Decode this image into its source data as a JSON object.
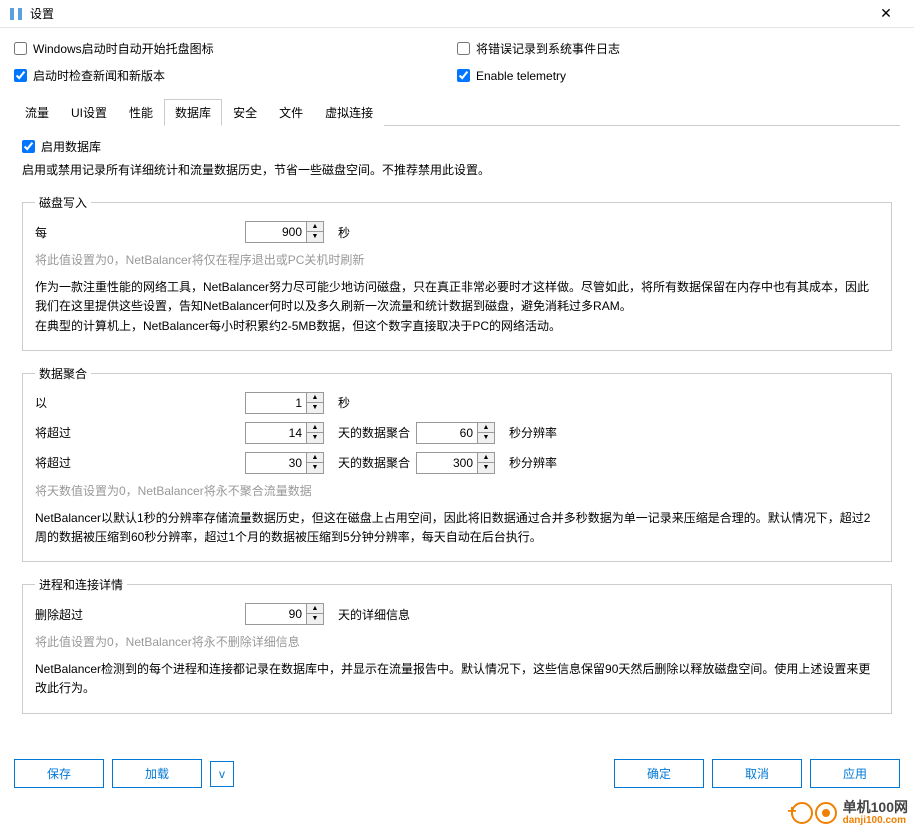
{
  "window": {
    "title": "设置",
    "close": "✕"
  },
  "checkboxes": {
    "tray": {
      "label": "Windows启动时自动开始托盘图标",
      "checked": false
    },
    "syslog": {
      "label": "将错误记录到系统事件日志",
      "checked": false
    },
    "news": {
      "label": "启动时检查新闻和新版本",
      "checked": true
    },
    "telemetry": {
      "label": "Enable telemetry",
      "checked": true
    }
  },
  "tabs": {
    "items": [
      {
        "label": "流量"
      },
      {
        "label": "UI设置"
      },
      {
        "label": "性能"
      },
      {
        "label": "数据库"
      },
      {
        "label": "安全"
      },
      {
        "label": "文件"
      },
      {
        "label": "虚拟连接"
      }
    ],
    "activeIndex": 3
  },
  "database": {
    "enable": {
      "label": "启用数据库",
      "checked": true
    },
    "desc": "启用或禁用记录所有详细统计和流量数据历史，节省一些磁盘空间。不推荐禁用此设置。",
    "diskWrite": {
      "legend": "磁盘写入",
      "everyLabel": "每",
      "interval": "900",
      "unit": "秒",
      "hint": "将此值设置为0，NetBalancer将仅在程序退出或PC关机时刷新",
      "para": "作为一款注重性能的网络工具，NetBalancer努力尽可能少地访问磁盘，只在真正非常必要时才这样做。尽管如此，将所有数据保留在内存中也有其成本，因此我们在这里提供这些设置，告知NetBalancer何时以及多久刷新一次流量和统计数据到磁盘，避免消耗过多RAM。\n在典型的计算机上，NetBalancer每小时积累约2-5MB数据，但这个数字直接取决于PC的网络活动。"
    },
    "aggregation": {
      "legend": "数据聚合",
      "byLabel": "以",
      "byValue": "1",
      "byUnit": "秒",
      "overLabel": "将超过",
      "over1Days": "14",
      "over1Mid": "天的数据聚合",
      "over1Res": "60",
      "over1Unit": "秒分辨率",
      "over2Days": "30",
      "over2Mid": "天的数据聚合",
      "over2Res": "300",
      "over2Unit": "秒分辨率",
      "hint": "将天数值设置为0，NetBalancer将永不聚合流量数据",
      "para": "NetBalancer以默认1秒的分辨率存储流量数据历史，但这在磁盘上占用空间，因此将旧数据通过合并多秒数据为单一记录来压缩是合理的。默认情况下，超过2周的数据被压缩到60秒分辨率，超过1个月的数据被压缩到5分钟分辨率，每天自动在后台执行。"
    },
    "details": {
      "legend": "进程和连接详情",
      "deleteLabel": "删除超过",
      "days": "90",
      "unit": "天的详细信息",
      "hint": "将此值设置为0，NetBalancer将永不删除详细信息",
      "para": "NetBalancer检测到的每个进程和连接都记录在数据库中，并显示在流量报告中。默认情况下，这些信息保留90天然后删除以释放磁盘空间。使用上述设置来更改此行为。"
    }
  },
  "buttons": {
    "save": "保存",
    "load": "加载",
    "dropdown": "v",
    "ok": "确定",
    "cancel": "取消",
    "apply": "应用"
  },
  "watermark": {
    "text": "单机100网",
    "url": "danji100.com"
  }
}
